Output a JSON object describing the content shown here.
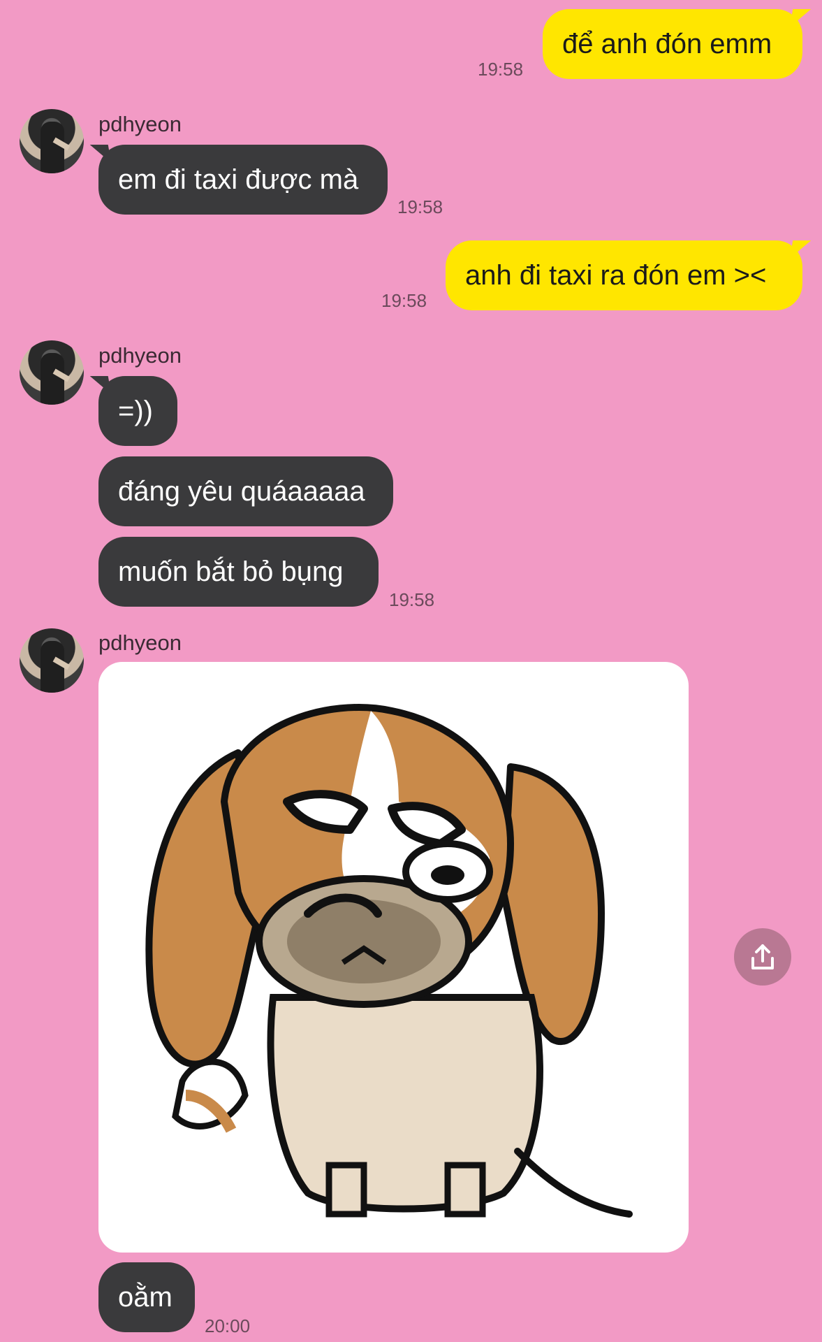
{
  "colors": {
    "background": "#f29ac5",
    "outgoing_bubble": "#ffe600",
    "incoming_bubble": "#3a3a3c"
  },
  "messages": [
    {
      "direction": "out",
      "text": "để anh đón emm",
      "time": "19:58"
    },
    {
      "direction": "in",
      "sender": "pdhyeon",
      "text": "em đi taxi được mà",
      "time": "19:58"
    },
    {
      "direction": "out",
      "text": "anh đi taxi ra đón em ><",
      "time": "19:58"
    },
    {
      "direction": "in",
      "sender": "pdhyeon",
      "texts": [
        "=))",
        "đáng yêu quáaaaaa",
        "muốn bắt bỏ bụng"
      ],
      "time": "19:58"
    },
    {
      "direction": "in",
      "sender": "pdhyeon",
      "sticker": "beagle-dog-sticker",
      "text": "oằm",
      "time": "20:00"
    }
  ],
  "icons": {
    "share": "share-upload-icon",
    "avatar": "user-avatar"
  }
}
